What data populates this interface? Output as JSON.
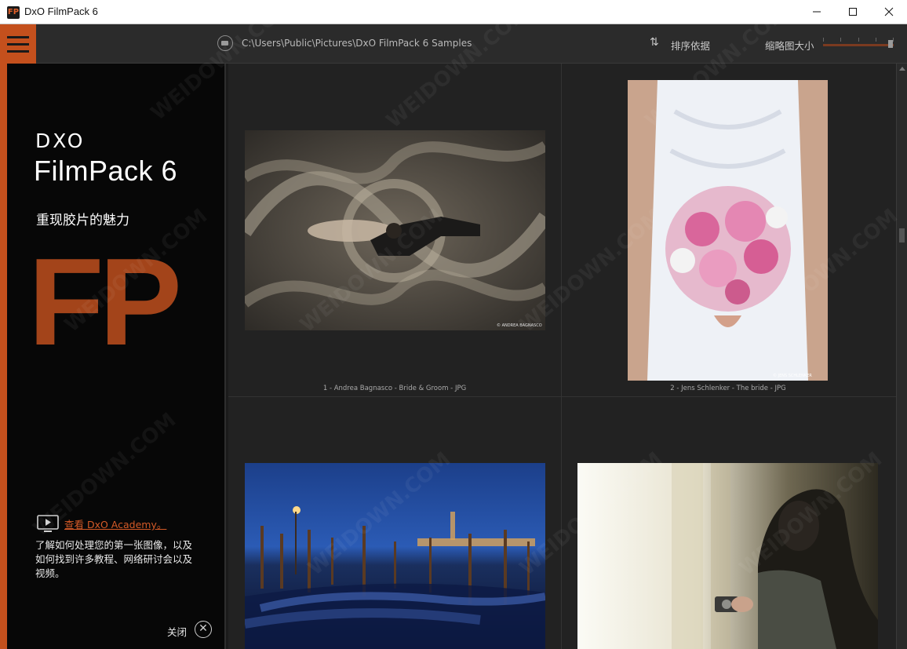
{
  "window": {
    "app_icon_text": "FP",
    "title": "DxO FilmPack 6"
  },
  "toolbar": {
    "path": "C:\\Users\\Public\\Pictures\\DxO FilmPack 6 Samples",
    "sort_icon": "⇅",
    "sort_label": "排序依据",
    "thumb_size_label": "缩略图大小"
  },
  "sidebar": {
    "brand": "DXO",
    "product": "FilmPack 6",
    "tagline": "重现胶片的魅力",
    "mark": "FP",
    "academy_link": "查看 DxO Academy。",
    "academy_desc": "了解如何处理您的第一张图像，以及如何找到许多教程、网络研讨会以及视频。",
    "close_label": "关闭",
    "close_icon": "✕"
  },
  "grid": {
    "items": [
      {
        "caption": "1 - Andrea Bagnasco - Bride & Groom - JPG",
        "credit": "© ANDREA BAGNASCO"
      },
      {
        "caption": "2 - Jens Schlenker - The bride - JPG",
        "credit": "© JENS SCHLENKER"
      },
      {
        "caption": "",
        "credit": ""
      },
      {
        "caption": "",
        "credit": ""
      }
    ]
  },
  "watermark": "WEIDOWN.COM",
  "colors": {
    "accent": "#c4501d",
    "mark": "#a3441a",
    "link": "#d45a27"
  }
}
